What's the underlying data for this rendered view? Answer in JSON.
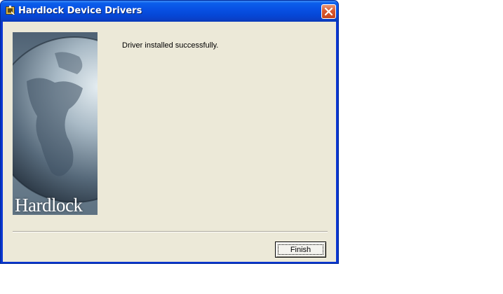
{
  "window": {
    "title": "Hardlock Device Drivers"
  },
  "dialog": {
    "message": "Driver installed successfully.",
    "brand_text": "Hardlock",
    "finish_label": "Finish"
  },
  "colors": {
    "titlebar": "#0851e4",
    "dialog_background": "#ece9d8",
    "close_button": "#d9582f"
  },
  "icons": {
    "title": "hardlock-app-icon",
    "close": "close-icon"
  }
}
